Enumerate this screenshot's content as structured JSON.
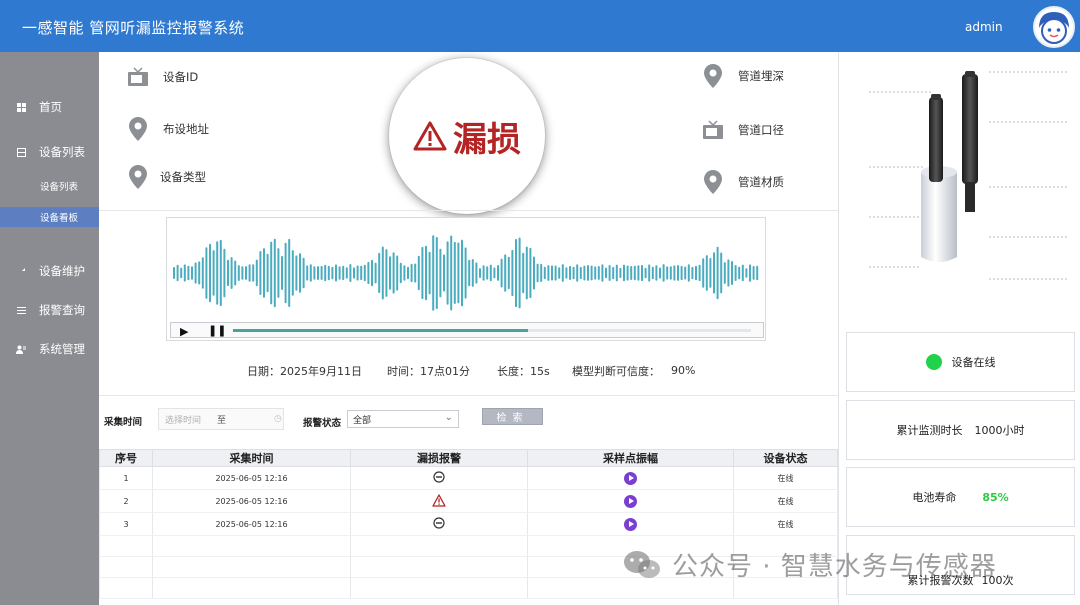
{
  "header": {
    "title": "一感智能 管网听漏监控报警系统",
    "user": "admin"
  },
  "sidebar": {
    "items": [
      {
        "label": "首页",
        "icon": "grid-icon"
      },
      {
        "label": "设备列表",
        "icon": "device-icon"
      },
      {
        "label": "设备维护",
        "icon": "wrench-icon"
      },
      {
        "label": "报警查询",
        "icon": "list-icon"
      },
      {
        "label": "系统管理",
        "icon": "users-icon"
      }
    ],
    "sub": [
      {
        "label": "设备列表"
      },
      {
        "label": "设备看板",
        "active": true
      }
    ]
  },
  "info": {
    "device_id": "设备ID",
    "address": "布设地址",
    "device_type": "设备类型",
    "pipe_depth": "管道埋深",
    "pipe_diameter": "管道口径",
    "pipe_material": "管道材质"
  },
  "leak_status": "漏损",
  "player": {
    "progress": 0.57
  },
  "meta": {
    "date": "日期：2025年9月11日",
    "time": "时间：17点01分",
    "length": "长度：15s",
    "confidence_label": "模型判断可信度：",
    "confidence_value": "90%"
  },
  "filter": {
    "time_label": "采集时间",
    "time_placeholder": "选择时间",
    "to": "至",
    "alarm_label": "报警状态",
    "alarm_value": "全部",
    "search": "检索"
  },
  "table": {
    "headers": [
      "序号",
      "采集时间",
      "漏损报警",
      "采样点振幅",
      "设备状态"
    ],
    "rows": [
      {
        "no": "1",
        "time": "2025-06-05   12:16",
        "alarm": "minus",
        "status": "在线"
      },
      {
        "no": "2",
        "time": "2025-06-05   12:16",
        "alarm": "warning",
        "status": "在线"
      },
      {
        "no": "3",
        "time": "2025-06-05   12:16",
        "alarm": "minus",
        "status": "在线"
      }
    ]
  },
  "right": {
    "online": "设备在线",
    "monitor_label": "累计监测时长",
    "monitor_value": "1000小时",
    "battery_label": "电池寿命",
    "battery_value": "85%",
    "alarm_count_label": "累计报警次数",
    "alarm_count_value": "100次"
  },
  "colors": {
    "header": "#2f7ad0",
    "sidebar": "#8a8c91",
    "wave": "#4aacbf",
    "leak": "#b52424",
    "online": "#22d24a",
    "battery": "#2ecc40"
  },
  "watermark": "公众号 · 智慧水务与传感器"
}
